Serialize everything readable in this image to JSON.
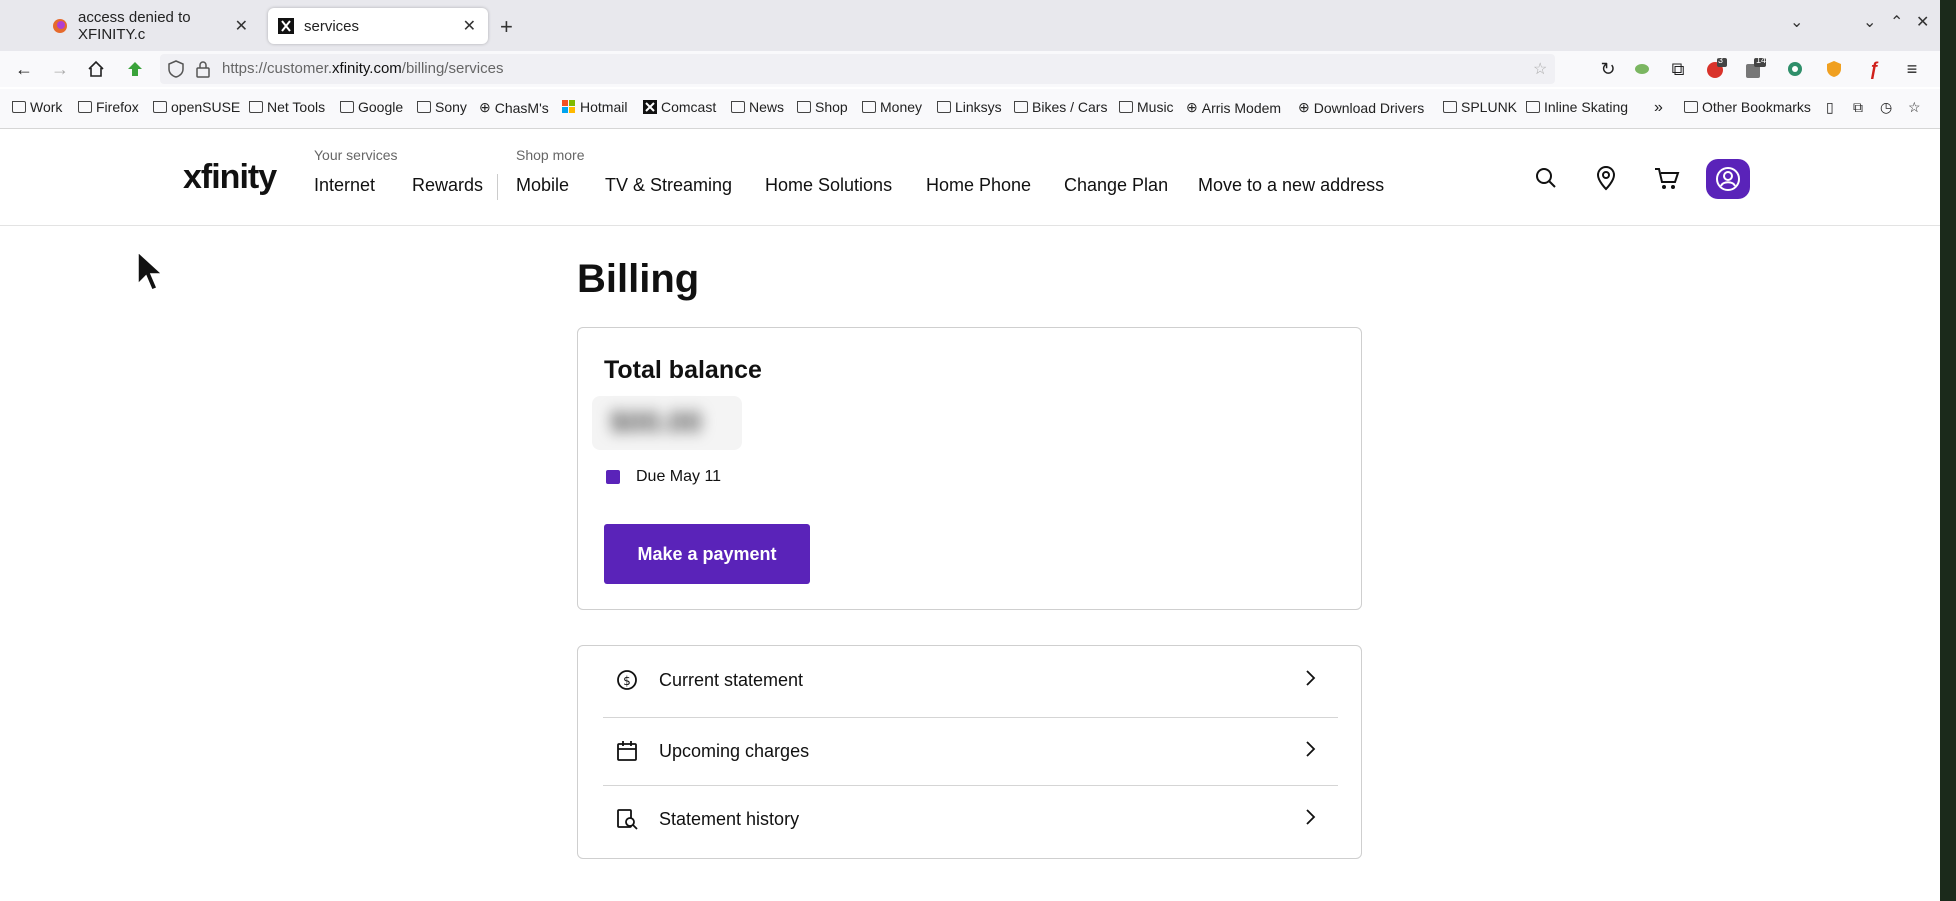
{
  "browser": {
    "tabs": [
      {
        "title": "access denied to XFINITY.c",
        "active": false
      },
      {
        "title": "services",
        "active": true
      }
    ],
    "url_prefix": "https://customer.",
    "url_domain": "xfinity.com",
    "url_path": "/billing/services",
    "bookmarks": [
      "Work",
      "Firefox",
      "openSUSE",
      "Net Tools",
      "Google",
      "Sony",
      "ChasM's",
      "Hotmail",
      "Comcast",
      "News",
      "Shop",
      "Money",
      "Linksys",
      "Bikes / Cars",
      "Music",
      "Arris Modem",
      "Download Drivers",
      "SPLUNK",
      "Inline Skating"
    ],
    "other_bookmarks": "Other Bookmarks",
    "badge_counts": [
      "3",
      "14"
    ]
  },
  "site": {
    "logo": "xfinity",
    "nav_label_services": "Your services",
    "nav_label_shop": "Shop more",
    "nav_links": [
      "Internet",
      "Rewards",
      "Mobile",
      "TV & Streaming",
      "Home Solutions",
      "Home Phone",
      "Change Plan",
      "Move to a new address"
    ]
  },
  "billing": {
    "title": "Billing",
    "total_label": "Total balance",
    "amount_hidden": "$00.00",
    "due": "Due May 11",
    "pay_button": "Make a payment",
    "links": [
      "Current statement",
      "Upcoming charges",
      "Statement history"
    ]
  },
  "colors": {
    "brand_purple": "#5a23b9"
  }
}
